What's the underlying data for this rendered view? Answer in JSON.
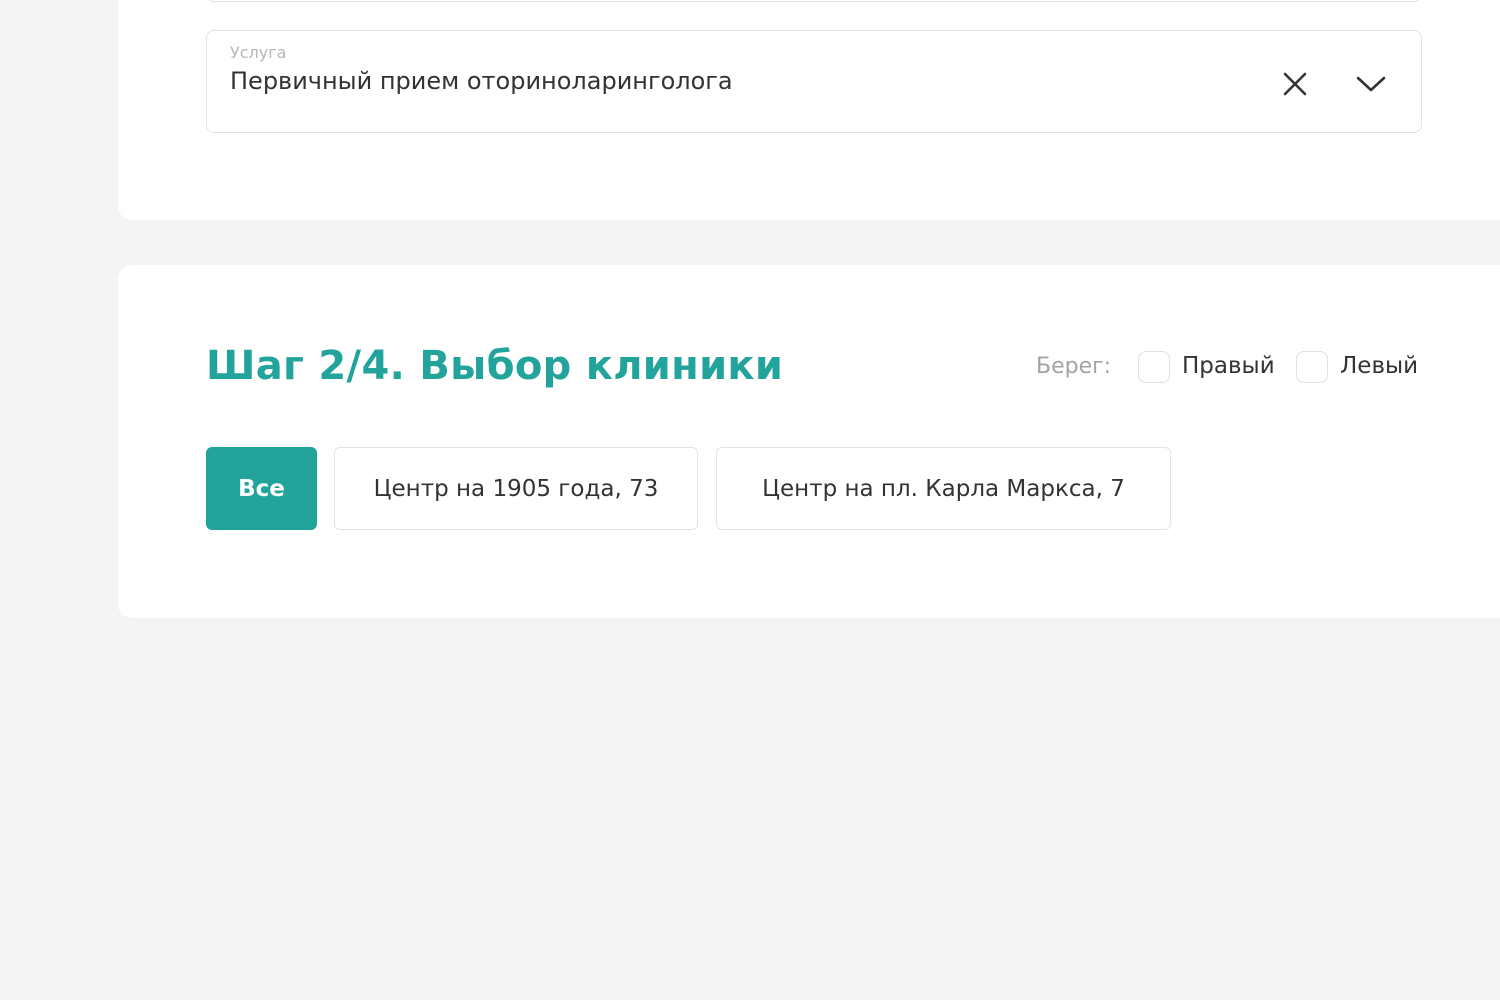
{
  "service_field": {
    "label": "Услуга",
    "value": "Первичный прием оториноларинголога",
    "clear_icon": "close-icon",
    "expand_icon": "chevron-down-icon"
  },
  "step": {
    "title": "Шаг 2/4. Выбор клиники"
  },
  "bank_filter": {
    "label": "Берег:",
    "options": [
      {
        "label": "Правый",
        "checked": false
      },
      {
        "label": "Левый",
        "checked": false
      }
    ]
  },
  "clinics": [
    {
      "label": "Все",
      "selected": true
    },
    {
      "label": "Центр на 1905 года, 73",
      "selected": false
    },
    {
      "label": "Центр на пл. Карла Маркса, 7",
      "selected": false
    }
  ],
  "colors": {
    "accent": "#22a39b",
    "background": "#f4f4f4",
    "card": "#ffffff",
    "text": "#333333",
    "muted": "#a3a3a3"
  }
}
